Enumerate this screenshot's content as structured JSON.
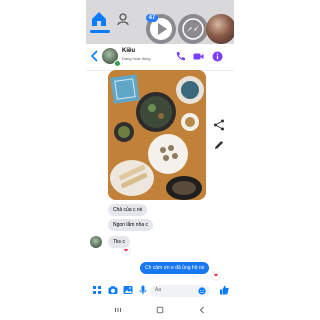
{
  "colors": {
    "accent": "#0a7cff",
    "outgoing_bubble": "#1877f2",
    "incoming_bubble": "#e4e6eb",
    "online": "#31a24c",
    "reaction_heart": "#f02849"
  },
  "top_nav": {
    "home_icon": "home-icon",
    "people_icon": "people-icon",
    "badge_count": "47",
    "bubbles": [
      "play-icon",
      "messenger-icon",
      "avatar"
    ]
  },
  "chat_header": {
    "name": "Kiều",
    "status": "Đang hoạt động",
    "icons": [
      "back-arrow-icon",
      "phone-icon",
      "video-icon",
      "info-icon"
    ]
  },
  "side_actions": [
    "share-icon",
    "edit-icon"
  ],
  "messages": [
    {
      "id": "m1",
      "text": "Chả của c nè",
      "from": "them"
    },
    {
      "id": "m2",
      "text": "Ngon lắm nha c",
      "from": "them"
    },
    {
      "id": "m3",
      "text": "Tks c",
      "from": "them"
    },
    {
      "id": "m4",
      "text": "Ch cảm ơn e đã ủng hộ nè",
      "from": "me"
    }
  ],
  "reactions": [
    "❤",
    "❤"
  ],
  "composer": {
    "placeholder": "Aa",
    "icons": [
      "menu-grid-icon",
      "camera-icon",
      "image-icon",
      "mic-icon",
      "emoji-icon",
      "like-icon"
    ]
  },
  "system_nav": [
    "recent-apps-icon",
    "home-button-icon",
    "back-icon"
  ]
}
